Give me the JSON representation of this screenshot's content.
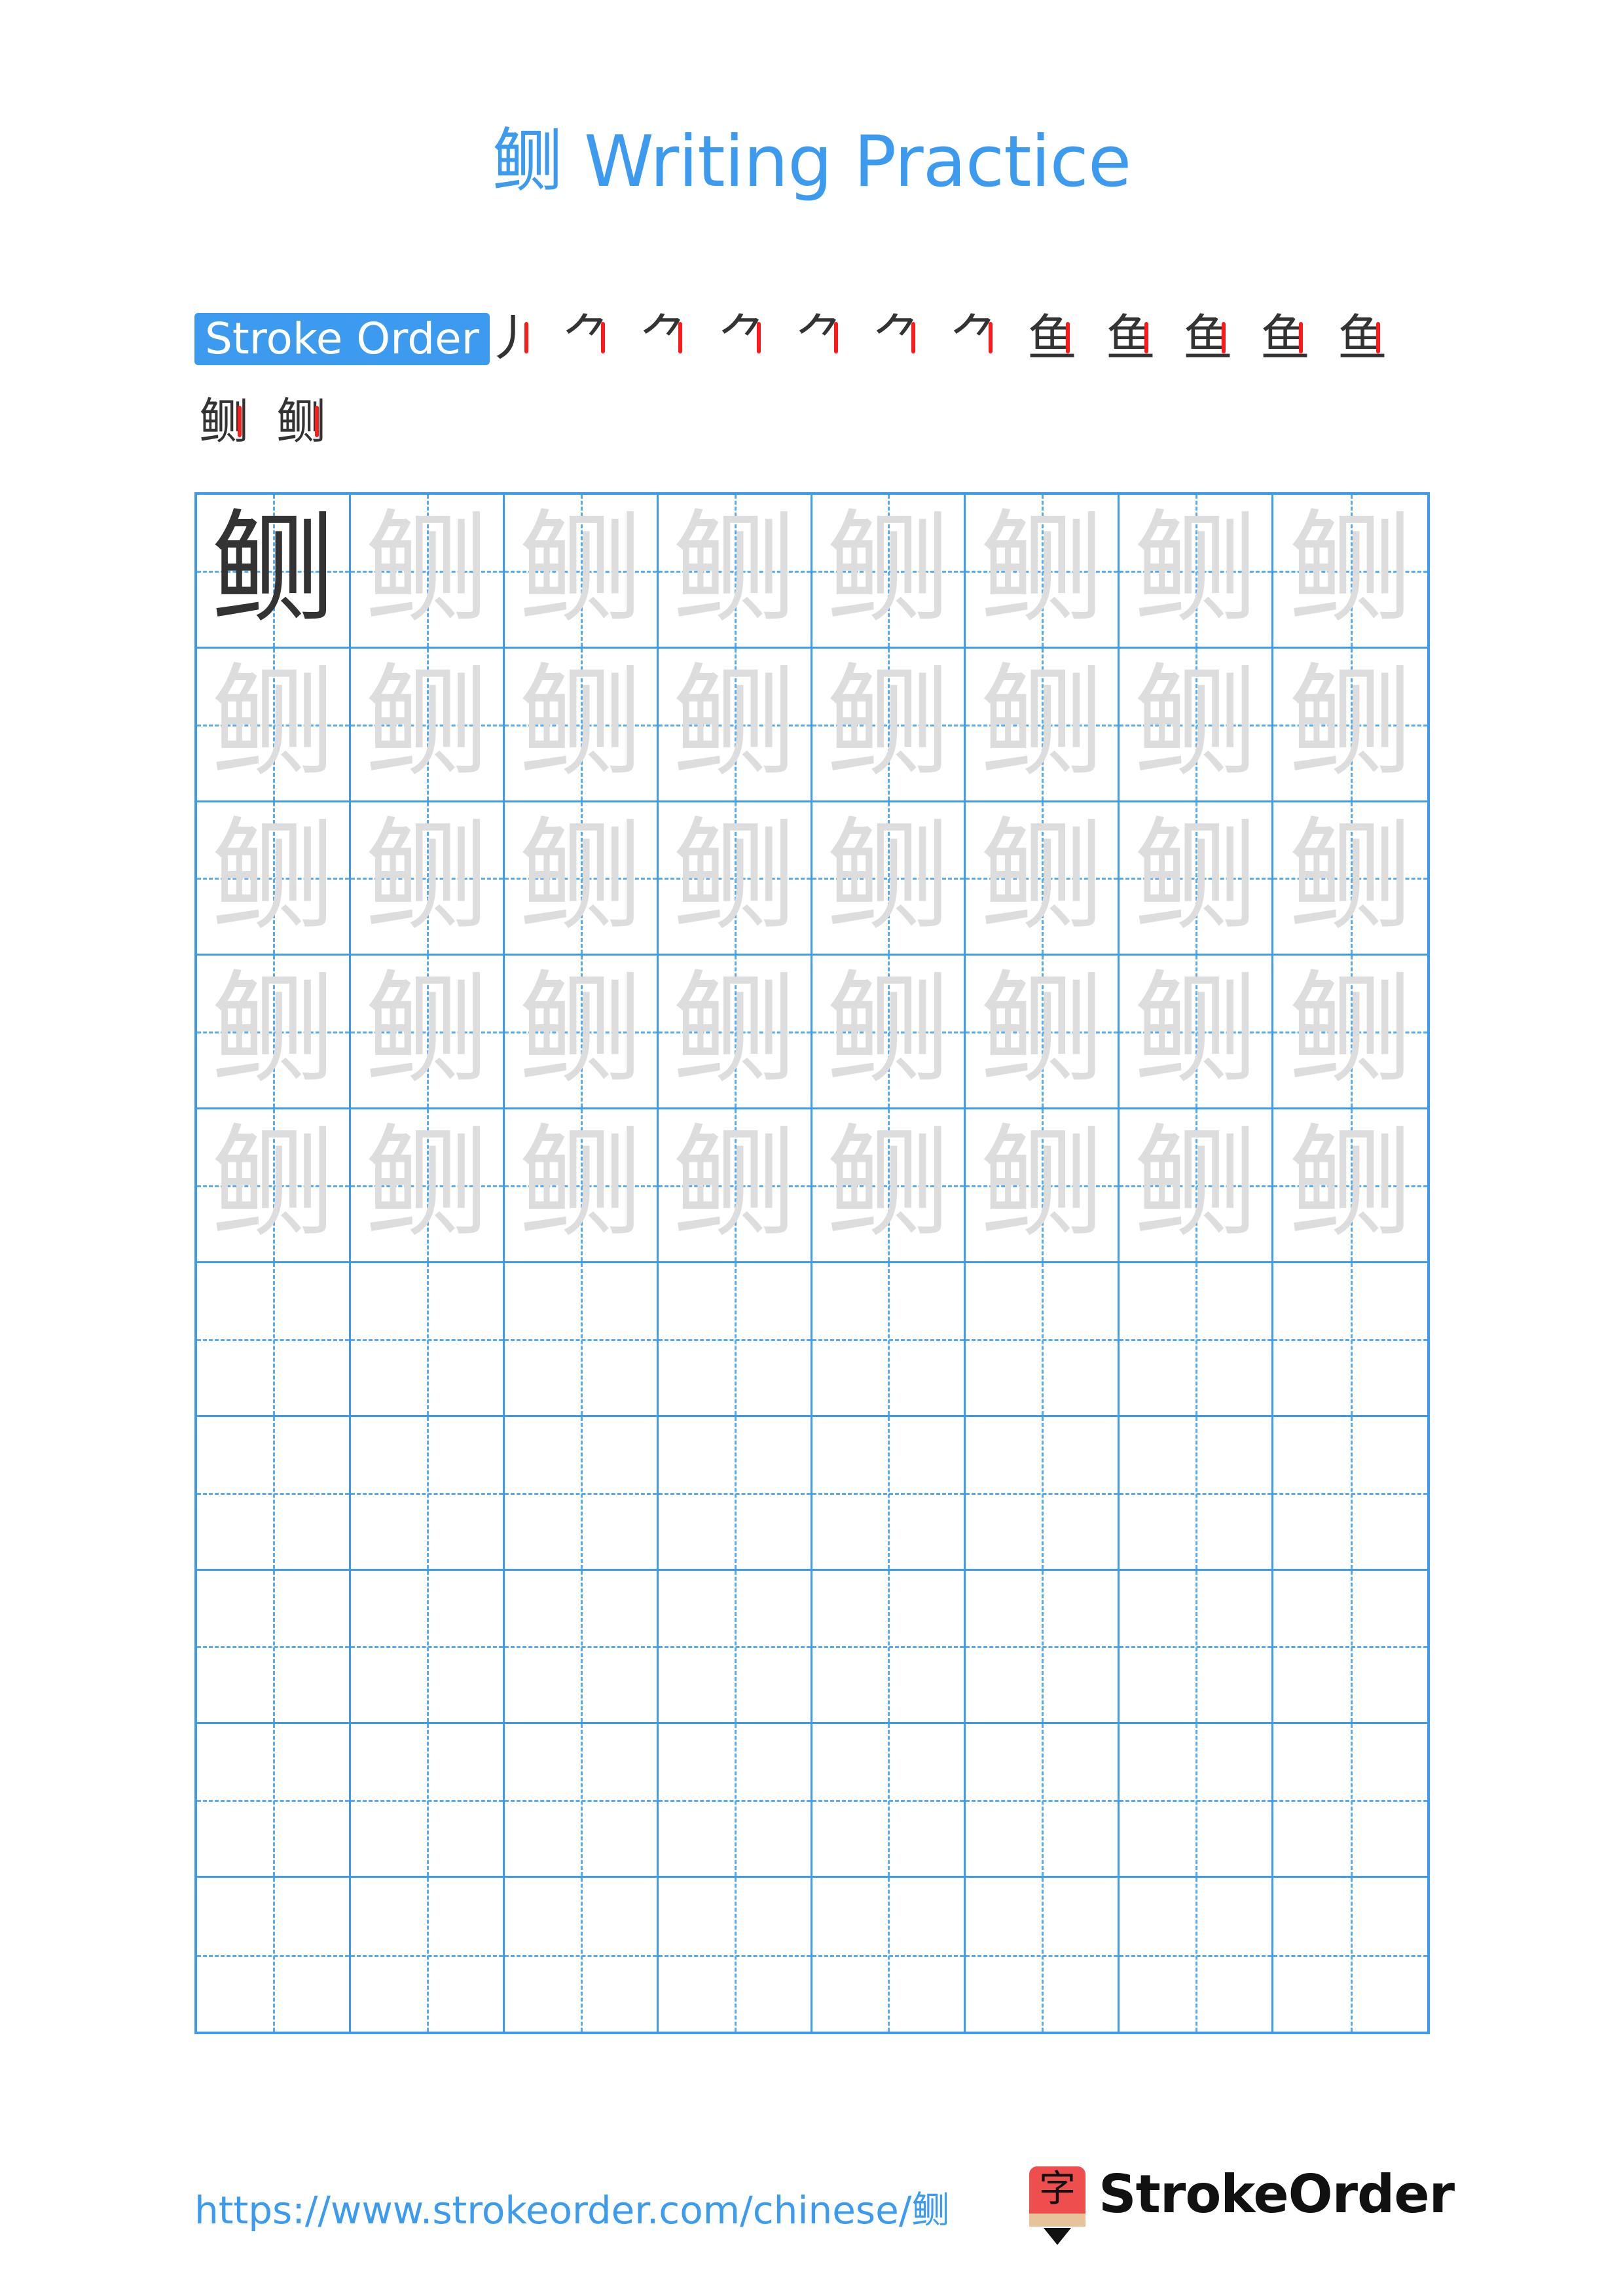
{
  "page": {
    "title": "鲗 Writing Practice",
    "character": "鲗",
    "colors": {
      "accent": "#3d9bef",
      "model_char": "#333333",
      "trace_char": "#dddddd",
      "highlight_stroke": "#ff1a1a"
    }
  },
  "stroke_order": {
    "label": "Stroke Order",
    "stroke_count": 14,
    "steps": [
      "丿",
      "⺈",
      "⺈",
      "⺈",
      "⺈",
      "⺈",
      "⺈",
      "鱼",
      "鱼",
      "鱼",
      "鱼",
      "鱼",
      "鲗",
      "鲗"
    ]
  },
  "grid": {
    "columns": 8,
    "rows": 10,
    "model_cells": 1,
    "trace_rows": 5,
    "blank_rows": 5
  },
  "footer": {
    "url": "https://www.strokeorder.com/chinese/鲗",
    "logo_glyph": "字",
    "logo_text": "StrokeOrder"
  }
}
